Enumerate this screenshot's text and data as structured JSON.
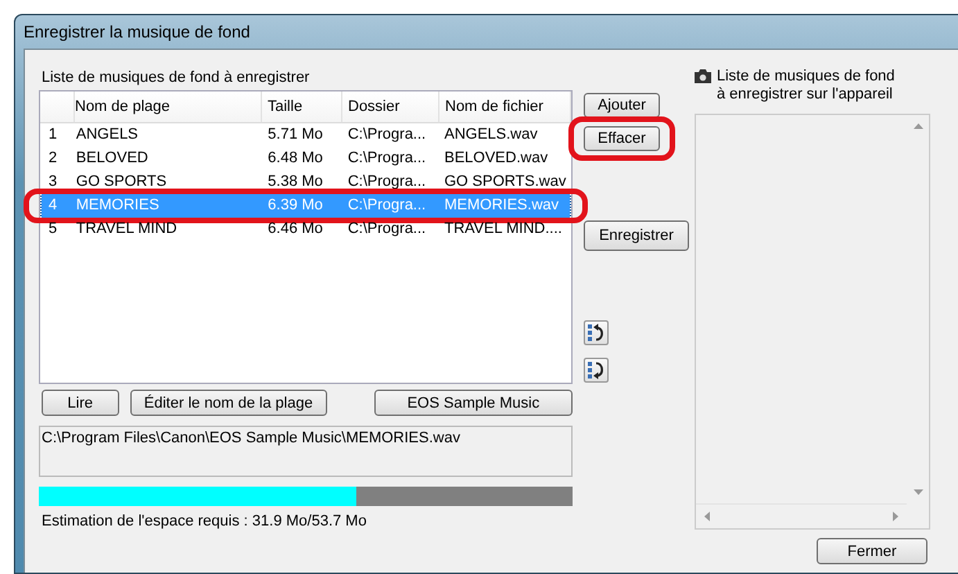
{
  "window": {
    "title": "Enregistrer la musique de fond"
  },
  "list_panel": {
    "label": "Liste de musiques de fond à enregistrer",
    "columns": [
      "Nom de plage",
      "Taille",
      "Dossier",
      "Nom de fichier"
    ],
    "rows": [
      {
        "number": "1",
        "name": "ANGELS",
        "size": "5.71 Mo",
        "folder": "C:\\Progra...",
        "file": "ANGELS.wav",
        "selected": false,
        "highlighted": false
      },
      {
        "number": "2",
        "name": "BELOVED",
        "size": "6.48 Mo",
        "folder": "C:\\Progra...",
        "file": "BELOVED.wav",
        "selected": false,
        "highlighted": false
      },
      {
        "number": "3",
        "name": "GO SPORTS",
        "size": "5.38 Mo",
        "folder": "C:\\Progra...",
        "file": "GO SPORTS.wav",
        "selected": false,
        "highlighted": false
      },
      {
        "number": "4",
        "name": "MEMORIES",
        "size": "6.39 Mo",
        "folder": "C:\\Progra...",
        "file": "MEMORIES.wav",
        "selected": true,
        "highlighted": true
      },
      {
        "number": "5",
        "name": "TRAVEL MIND",
        "size": "6.46 Mo",
        "folder": "C:\\Progra...",
        "file": "TRAVEL MIND....",
        "selected": false,
        "highlighted": false
      }
    ]
  },
  "side_buttons": [
    {
      "label": "Ajouter",
      "highlighted": false
    },
    {
      "label": "Effacer",
      "highlighted": true
    }
  ],
  "register_button": "Enregistrer",
  "bottom_buttons": [
    "Lire",
    "Éditer le nom de la plage",
    "EOS Sample Music"
  ],
  "path": "C:\\Program Files\\Canon\\EOS Sample Music\\MEMORIES.wav",
  "space": {
    "level": 0.594,
    "label": "Estimation de l'espace requis : 31.9 Mo/53.7 Mo"
  },
  "camera_panel": {
    "label_lines": [
      "Liste de musiques de fond",
      "à enregistrer sur l'appareil"
    ]
  },
  "close_button": "Fermer"
}
